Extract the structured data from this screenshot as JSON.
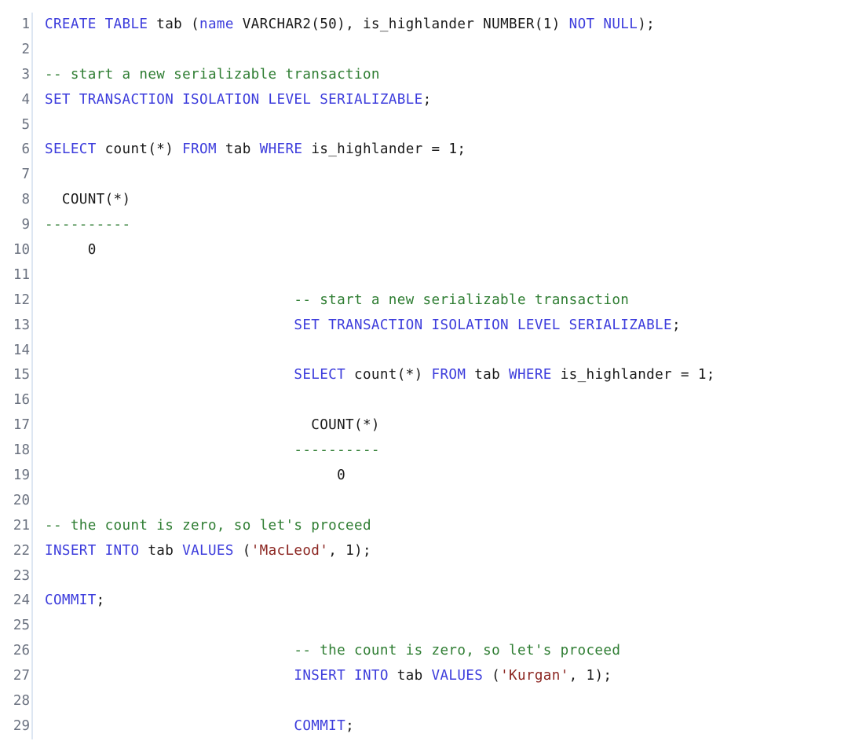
{
  "document": {
    "type": "sql-code-listing",
    "language": "SQL",
    "total_lines": 29,
    "theme": {
      "background": "#ffffff",
      "text": "#1a1a1a",
      "keyword": "#3c3cdc",
      "comment": "#2e7d32",
      "string": "#8b2520",
      "line_number": "#6b7280",
      "gutter_divider": "#dde6f2"
    }
  },
  "lines": [
    {
      "number": "1",
      "tokens": [
        {
          "text": "CREATE TABLE",
          "type": "keyword"
        },
        {
          "text": " tab (",
          "type": "plain"
        },
        {
          "text": "name",
          "type": "keyword"
        },
        {
          "text": " VARCHAR2(50), is_highlander NUMBER(1) ",
          "type": "plain"
        },
        {
          "text": "NOT NULL",
          "type": "keyword"
        },
        {
          "text": ");",
          "type": "plain"
        }
      ]
    },
    {
      "number": "2",
      "tokens": []
    },
    {
      "number": "3",
      "tokens": [
        {
          "text": "-- start a new serializable transaction",
          "type": "comment"
        }
      ]
    },
    {
      "number": "4",
      "tokens": [
        {
          "text": "SET TRANSACTION ISOLATION LEVEL SERIALIZABLE",
          "type": "keyword"
        },
        {
          "text": ";",
          "type": "plain"
        }
      ]
    },
    {
      "number": "5",
      "tokens": []
    },
    {
      "number": "6",
      "tokens": [
        {
          "text": "SELECT",
          "type": "keyword"
        },
        {
          "text": " count(*) ",
          "type": "plain"
        },
        {
          "text": "FROM",
          "type": "keyword"
        },
        {
          "text": " tab ",
          "type": "plain"
        },
        {
          "text": "WHERE",
          "type": "keyword"
        },
        {
          "text": " is_highlander = 1;",
          "type": "plain"
        }
      ]
    },
    {
      "number": "7",
      "tokens": []
    },
    {
      "number": "8",
      "tokens": [
        {
          "text": "  COUNT(*)",
          "type": "plain"
        }
      ]
    },
    {
      "number": "9",
      "tokens": [
        {
          "text": "----------",
          "type": "comment"
        }
      ]
    },
    {
      "number": "10",
      "tokens": [
        {
          "text": "     0",
          "type": "plain"
        }
      ]
    },
    {
      "number": "11",
      "tokens": []
    },
    {
      "number": "12",
      "tokens": [
        {
          "text": "                             -- start a new serializable transaction",
          "type": "comment"
        }
      ]
    },
    {
      "number": "13",
      "tokens": [
        {
          "text": "                             ",
          "type": "plain"
        },
        {
          "text": "SET TRANSACTION ISOLATION LEVEL SERIALIZABLE",
          "type": "keyword"
        },
        {
          "text": ";",
          "type": "plain"
        }
      ]
    },
    {
      "number": "14",
      "tokens": []
    },
    {
      "number": "15",
      "tokens": [
        {
          "text": "                             ",
          "type": "plain"
        },
        {
          "text": "SELECT",
          "type": "keyword"
        },
        {
          "text": " count(*) ",
          "type": "plain"
        },
        {
          "text": "FROM",
          "type": "keyword"
        },
        {
          "text": " tab ",
          "type": "plain"
        },
        {
          "text": "WHERE",
          "type": "keyword"
        },
        {
          "text": " is_highlander = 1;",
          "type": "plain"
        }
      ]
    },
    {
      "number": "16",
      "tokens": []
    },
    {
      "number": "17",
      "tokens": [
        {
          "text": "                               COUNT(*)",
          "type": "plain"
        }
      ]
    },
    {
      "number": "18",
      "tokens": [
        {
          "text": "                             ",
          "type": "plain"
        },
        {
          "text": "----------",
          "type": "comment"
        }
      ]
    },
    {
      "number": "19",
      "tokens": [
        {
          "text": "                                  0",
          "type": "plain"
        }
      ]
    },
    {
      "number": "20",
      "tokens": []
    },
    {
      "number": "21",
      "tokens": [
        {
          "text": "-- the count is zero, so let's proceed",
          "type": "comment"
        }
      ]
    },
    {
      "number": "22",
      "tokens": [
        {
          "text": "INSERT INTO",
          "type": "keyword"
        },
        {
          "text": " tab ",
          "type": "plain"
        },
        {
          "text": "VALUES",
          "type": "keyword"
        },
        {
          "text": " (",
          "type": "plain"
        },
        {
          "text": "'MacLeod'",
          "type": "string"
        },
        {
          "text": ", 1);",
          "type": "plain"
        }
      ]
    },
    {
      "number": "23",
      "tokens": []
    },
    {
      "number": "24",
      "tokens": [
        {
          "text": "COMMIT",
          "type": "keyword"
        },
        {
          "text": ";",
          "type": "plain"
        }
      ]
    },
    {
      "number": "25",
      "tokens": []
    },
    {
      "number": "26",
      "tokens": [
        {
          "text": "                             -- the count is zero, so let's proceed",
          "type": "comment"
        }
      ]
    },
    {
      "number": "27",
      "tokens": [
        {
          "text": "                             ",
          "type": "plain"
        },
        {
          "text": "INSERT INTO",
          "type": "keyword"
        },
        {
          "text": " tab ",
          "type": "plain"
        },
        {
          "text": "VALUES",
          "type": "keyword"
        },
        {
          "text": " (",
          "type": "plain"
        },
        {
          "text": "'Kurgan'",
          "type": "string"
        },
        {
          "text": ", 1);",
          "type": "plain"
        }
      ]
    },
    {
      "number": "28",
      "tokens": []
    },
    {
      "number": "29",
      "tokens": [
        {
          "text": "                             ",
          "type": "plain"
        },
        {
          "text": "COMMIT",
          "type": "keyword"
        },
        {
          "text": ";",
          "type": "plain"
        }
      ]
    }
  ]
}
